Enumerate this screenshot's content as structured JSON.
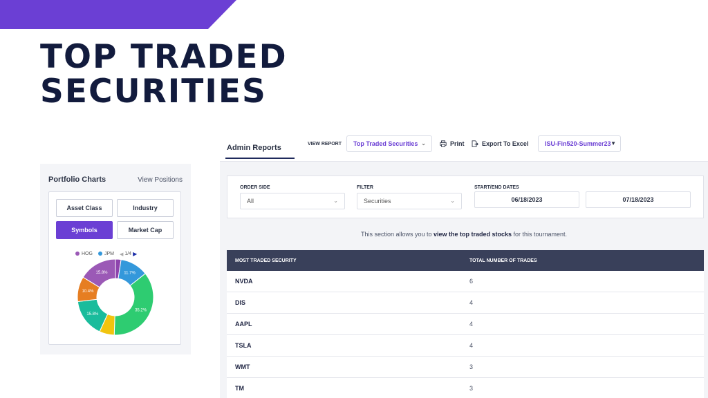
{
  "slide": {
    "title_line1": "TOP TRADED",
    "title_line2": "SECURITIES",
    "accent_color": "#6b3fd4",
    "title_color": "#121b3d"
  },
  "portfolio": {
    "title": "Portfolio Charts",
    "view_positions": "View Positions",
    "buttons": [
      "Asset Class",
      "Industry",
      "Symbols",
      "Market Cap"
    ],
    "active_button": "Symbols",
    "legend": [
      {
        "label": "HOG",
        "color": "#9b59b6"
      },
      {
        "label": "JPM",
        "color": "#3498db"
      }
    ],
    "pager": "1/4",
    "slices": [
      {
        "value": 2.3,
        "color": "#8e44ad",
        "label": ""
      },
      {
        "value": 11.7,
        "color": "#3498db",
        "label": "11.7%"
      },
      {
        "value": 35.2,
        "color": "#2ecc71",
        "label": "35.2%"
      },
      {
        "value": 6.2,
        "color": "#f1c40f",
        "label": ""
      },
      {
        "value": 15.8,
        "color": "#1abc9c",
        "label": "15.8%"
      },
      {
        "value": 10.4,
        "color": "#e67e22",
        "label": "10.4%"
      },
      {
        "value": 15.8,
        "color": "#9b59b6",
        "label": "15.8%"
      }
    ]
  },
  "admin": {
    "tab": "Admin Reports",
    "view_report_label": "VIEW REPORT",
    "report_selected": "Top Traded Securities",
    "print_label": "Print",
    "export_label": "Export To Excel",
    "tournament": "ISU-Fin520-Summer23",
    "filters": {
      "order_side_label": "ORDER SIDE",
      "order_side_value": "All",
      "filter_label": "FILTER",
      "filter_value": "Securities",
      "dates_label": "START/END DATES",
      "start_date": "06/18/2023",
      "end_date": "07/18/2023"
    },
    "info_prefix": "This section allows you to ",
    "info_bold": "view the top traded stocks",
    "info_suffix": " for this tournament.",
    "table": {
      "headers": [
        "MOST TRADED SECURITY",
        "TOTAL NUMBER OF TRADES"
      ],
      "rows": [
        {
          "symbol": "NVDA",
          "count": "6"
        },
        {
          "symbol": "DIS",
          "count": "4"
        },
        {
          "symbol": "AAPL",
          "count": "4"
        },
        {
          "symbol": "TSLA",
          "count": "4"
        },
        {
          "symbol": "WMT",
          "count": "3"
        },
        {
          "symbol": "TM",
          "count": "3"
        }
      ]
    }
  }
}
